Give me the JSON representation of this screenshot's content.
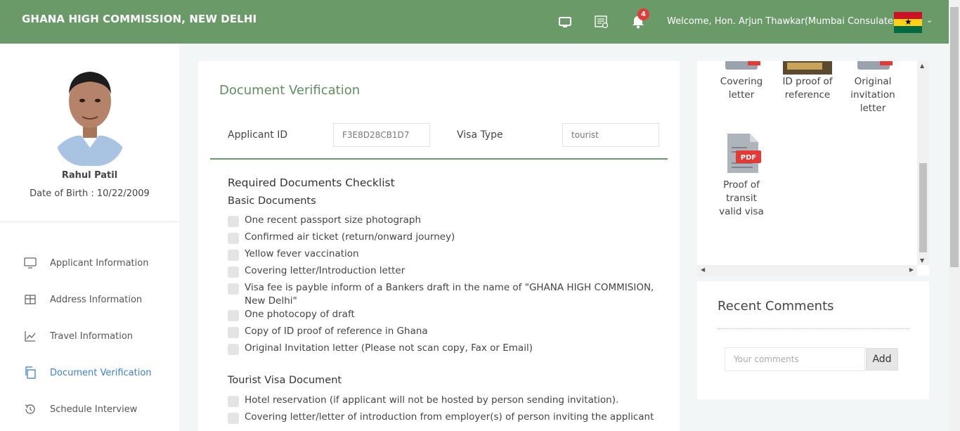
{
  "header": {
    "brand": "GHANA HIGH COMMISSION, NEW DELHI",
    "notification_count": "4",
    "welcome": "Welcome, Hon. Arjun Thawkar(Mumbai Consulates)",
    "icons": [
      "monitor-icon",
      "document-list-icon",
      "bell-icon",
      "chevron-down-icon"
    ]
  },
  "profile": {
    "name": "Rahul Patil",
    "dob": "Date of Birth : 10/22/2009"
  },
  "nav": {
    "items": [
      {
        "label": "Applicant Information",
        "icon": "monitor-icon"
      },
      {
        "label": "Address Information",
        "icon": "table-icon"
      },
      {
        "label": "Travel Information",
        "icon": "line-chart-icon"
      },
      {
        "label": "Document Verification",
        "icon": "copy-icon",
        "active": true
      },
      {
        "label": "Schedule Interview",
        "icon": "history-icon"
      }
    ]
  },
  "main": {
    "title": "Document Verification",
    "applicant_id_label": "Applicant ID",
    "applicant_id_value": "F3E8D28CB1D7",
    "visa_type_label": "Visa Type",
    "visa_type_value": "tourist",
    "checklist_title": "Required Documents Checklist",
    "basic_title": "Basic Documents",
    "basic_items": [
      "One recent passport size photograph",
      "Confirmed air ticket (return/onward journey)",
      "Yellow fever vaccination",
      "Covering letter/Introduction letter",
      "Visa fee is payble inform of a Bankers draft in the name of \"GHANA HIGH COMMISION, New Delhi\"",
      "One photocopy of draft",
      "Copy of ID proof of reference in Ghana",
      "Original Invitation letter (Please not scan copy, Fax or Email)"
    ],
    "tourist_title": "Tourist Visa Document",
    "tourist_items": [
      "Hotel reservation (if applicant will not be hosted by person sending invitation).",
      "Covering letter/letter of introduction from employer(s) of person inviting the applicant"
    ]
  },
  "documents": {
    "items": [
      {
        "label": "Covering letter"
      },
      {
        "label": "ID proof of reference"
      },
      {
        "label": "Original invitation letter"
      },
      {
        "label": "Proof of transit valid visa",
        "badge": "PDF"
      }
    ]
  },
  "comments": {
    "title": "Recent Comments",
    "placeholder": "Your comments",
    "add_label": "Add"
  },
  "colors": {
    "header": "#6a9a68",
    "accent_green": "#5e8f5e",
    "active_nav": "#3d7fd1",
    "badge": "#e23b3b"
  }
}
